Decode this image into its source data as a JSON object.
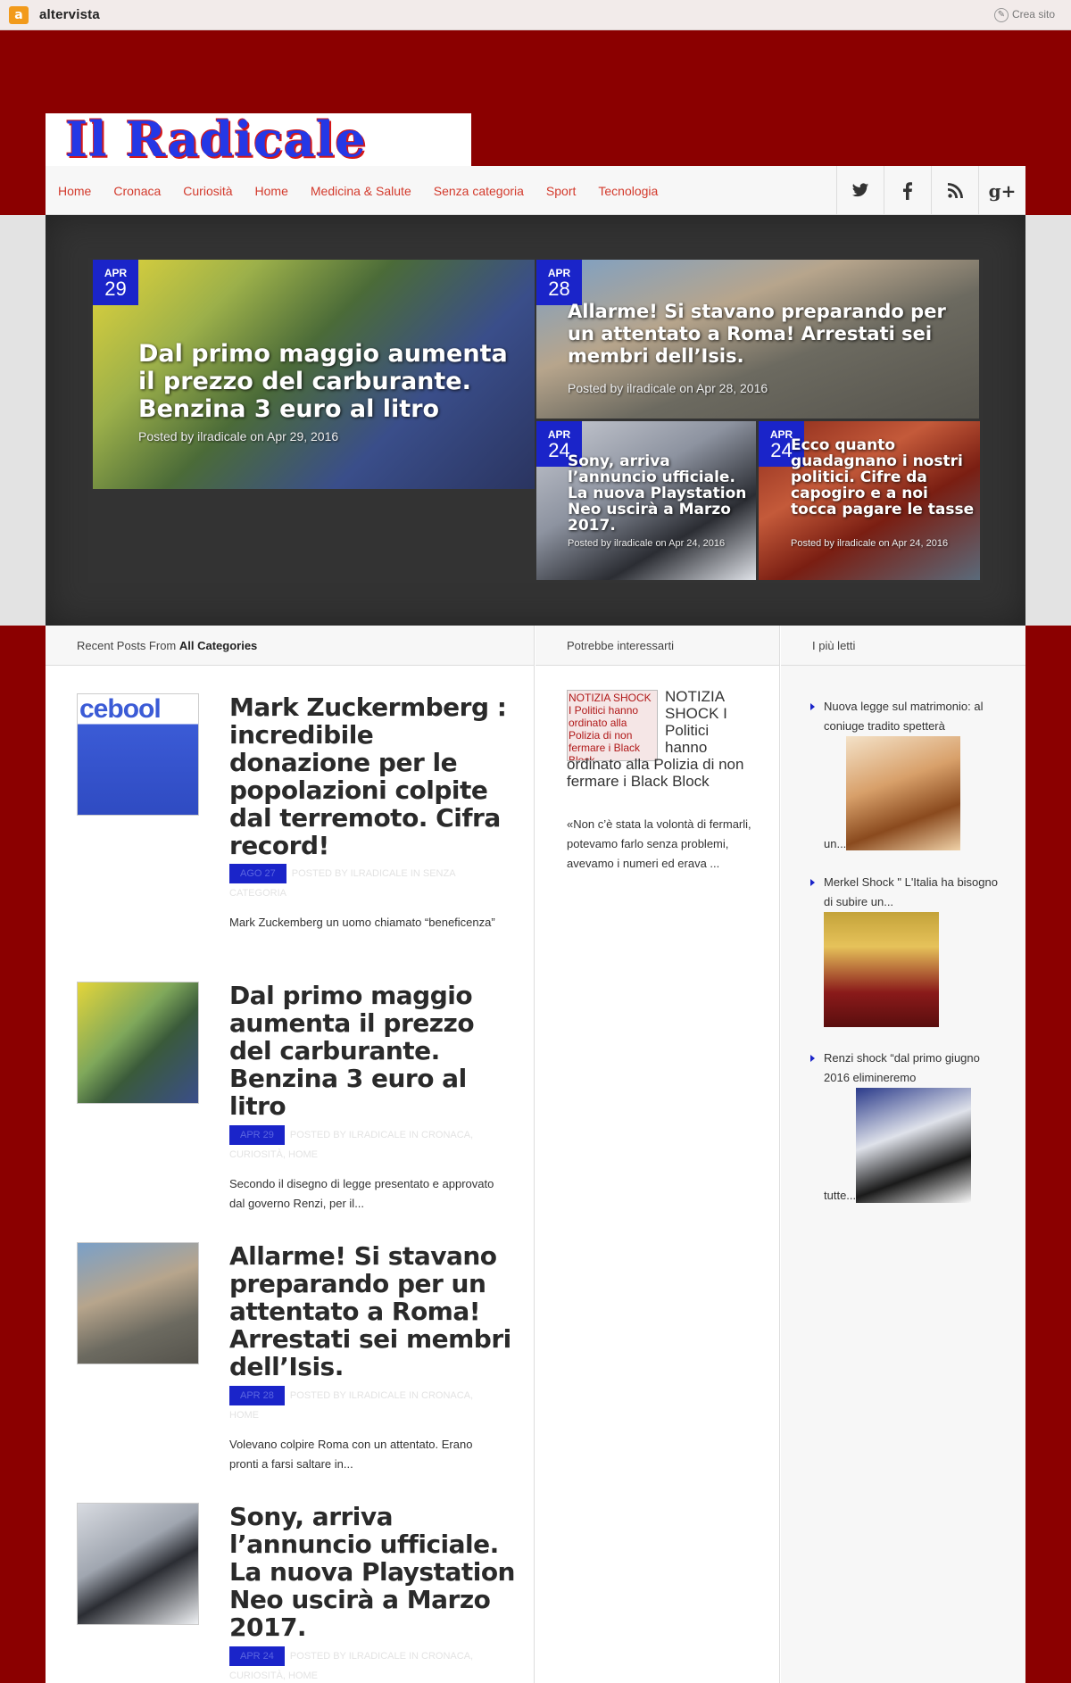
{
  "topbar": {
    "logo_letter": "a",
    "brand": "altervista",
    "create_site": "Crea sito"
  },
  "site": {
    "logo_text": "Il Radicale"
  },
  "nav": {
    "items": [
      "Home",
      "Cronaca",
      "Curiosità",
      "Home",
      "Medicina & Salute",
      "Senza categoria",
      "Sport",
      "Tecnologia"
    ]
  },
  "social": {
    "twitter": "t",
    "facebook": "f",
    "rss": "r",
    "googleplus": "g+"
  },
  "featured": [
    {
      "month": "APR",
      "day": "29",
      "title": "Dal primo maggio aumenta il prezzo del carburante. Benzina 3 euro al litro",
      "byline": "Posted by ilradicale on Apr 29, 2016"
    },
    {
      "month": "APR",
      "day": "28",
      "title": "Allarme! Si stavano preparando per un attentato a Roma! Arrestati sei membri dell’Isis.",
      "byline": "Posted by ilradicale on Apr 28, 2016"
    },
    {
      "month": "APR",
      "day": "24",
      "title": "Sony, arriva l’annuncio ufficiale. La nuova Playstation Neo uscirà a Marzo 2017.",
      "byline": "Posted by ilradicale on Apr 24, 2016"
    },
    {
      "month": "APR",
      "day": "24",
      "title": "Ecco quanto guadagnano i nostri politici. Cifre da capogiro e a noi tocca pagare le tasse",
      "byline": "Posted by ilradicale on Apr 24, 2016"
    }
  ],
  "col1": {
    "head_prefix": "Recent Posts From ",
    "head_bold": "All Categories"
  },
  "posts": [
    {
      "thumb_text": "cebool",
      "title": "Mark Zuckermberg : incredibile donazione per le popolazioni colpite dal terremoto. Cifra record!",
      "date": "AGO 27",
      "meta": "POSTED BY ILRADICALE IN SENZA CATEGORIA",
      "excerpt": "Mark Zuckemberg un uomo chiamato “beneficenza”"
    },
    {
      "title": "Dal primo maggio aumenta il prezzo del carburante. Benzina 3 euro al litro",
      "date": "APR 29",
      "meta": "POSTED BY ILRADICALE IN CRONACA, CURIOSITÀ, HOME",
      "excerpt": "Secondo il disegno di legge presentato e approvato dal governo Renzi, per il..."
    },
    {
      "title": "Allarme! Si stavano preparando per un attentato a Roma! Arrestati sei membri dell’Isis.",
      "date": "APR 28",
      "meta": "POSTED BY ILRADICALE IN CRONACA, HOME",
      "excerpt": "Volevano colpire Roma con un attentato. Erano pronti a farsi saltare in..."
    },
    {
      "title": "Sony, arriva l’annuncio ufficiale. La nuova Playstation Neo uscirà a Marzo 2017.",
      "date": "APR 24",
      "meta": "POSTED BY ILRADICALE IN CRONACA, CURIOSITÀ, HOME",
      "excerpt": ""
    }
  ],
  "col2": {
    "head": "Potrebbe interessarti",
    "img_alt": "NOTIZIA SHOCK I Politici hanno ordinato alla Polizia di non fermare i Black Block",
    "title": "NOTIZIA SHOCK I Politici hanno ordinato alla Polizia di non fermare i Black Block",
    "excerpt": "«Non c’è stata la volontà di fermarli, potevamo farlo senza problemi, avevamo i numeri ed erava ..."
  },
  "col3": {
    "head": "I più letti",
    "items": [
      {
        "text": "Nuova legge sul matrimonio: al coniuge tradito spetterà",
        "tail": "un..."
      },
      {
        "text": "Merkel Shock \" L'Italia ha bisogno di subire un...",
        "tail": ""
      },
      {
        "text": "Renzi shock “dal primo giugno 2016 elimineremo",
        "tail": "tutte..."
      }
    ]
  }
}
